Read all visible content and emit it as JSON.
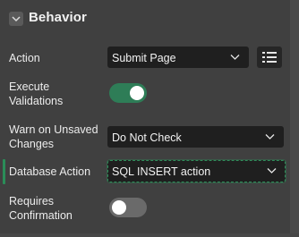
{
  "section": {
    "title": "Behavior"
  },
  "fields": {
    "action": {
      "label": "Action",
      "value": "Submit Page"
    },
    "execute_validations": {
      "label_line1": "Execute",
      "label_line2": "Validations",
      "enabled": true
    },
    "warn_unsaved": {
      "label_line1": "Warn on Unsaved",
      "label_line2": "Changes",
      "value": "Do Not Check"
    },
    "database_action": {
      "label": "Database Action",
      "value": "SQL INSERT action"
    },
    "requires_confirmation": {
      "label_line1": "Requires",
      "label_line2": "Confirmation",
      "enabled": false
    }
  },
  "icons": {
    "collapse": "chevron-down-icon",
    "list": "list-icon",
    "dropdown": "chevron-down-icon"
  },
  "colors": {
    "background": "#404040",
    "control": "#1f1f1f",
    "accent": "#2e7d57",
    "focus": "#2f8c5a",
    "text": "#f0f0f0"
  }
}
